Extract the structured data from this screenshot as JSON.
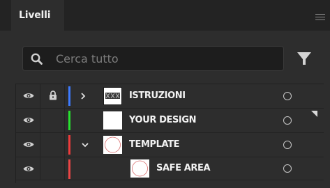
{
  "panel": {
    "tab_label": "Livelli",
    "menu_icon": "hamburger-menu-icon"
  },
  "search": {
    "placeholder": "Cerca tutto",
    "value": "",
    "search_icon": "magnifier-icon",
    "filter_icon": "filter-funnel-icon"
  },
  "colors": {
    "blue": "#3d7bff",
    "green": "#27e22f",
    "red": "#ee3b3b",
    "red2": "#ea4545"
  },
  "layers": [
    {
      "name": "ISTRUZIONI",
      "visible": true,
      "locked": true,
      "expanded": false,
      "has_children": true,
      "depth": 0,
      "color": "#3d7bff",
      "thumbnail": "instructions-thumbnail"
    },
    {
      "name": "YOUR DESIGN",
      "visible": true,
      "locked": false,
      "has_children": false,
      "depth": 0,
      "color": "#27e22f",
      "thumbnail": "blank-thumbnail"
    },
    {
      "name": "TEMPLATE",
      "visible": true,
      "locked": false,
      "expanded": true,
      "has_children": true,
      "depth": 0,
      "color": "#ee3b3b",
      "thumbnail": "circle-thumbnail"
    },
    {
      "name": "SAFE AREA",
      "visible": true,
      "locked": false,
      "has_children": false,
      "depth": 1,
      "color": "#ea4545",
      "thumbnail": "circle-thumbnail"
    }
  ]
}
